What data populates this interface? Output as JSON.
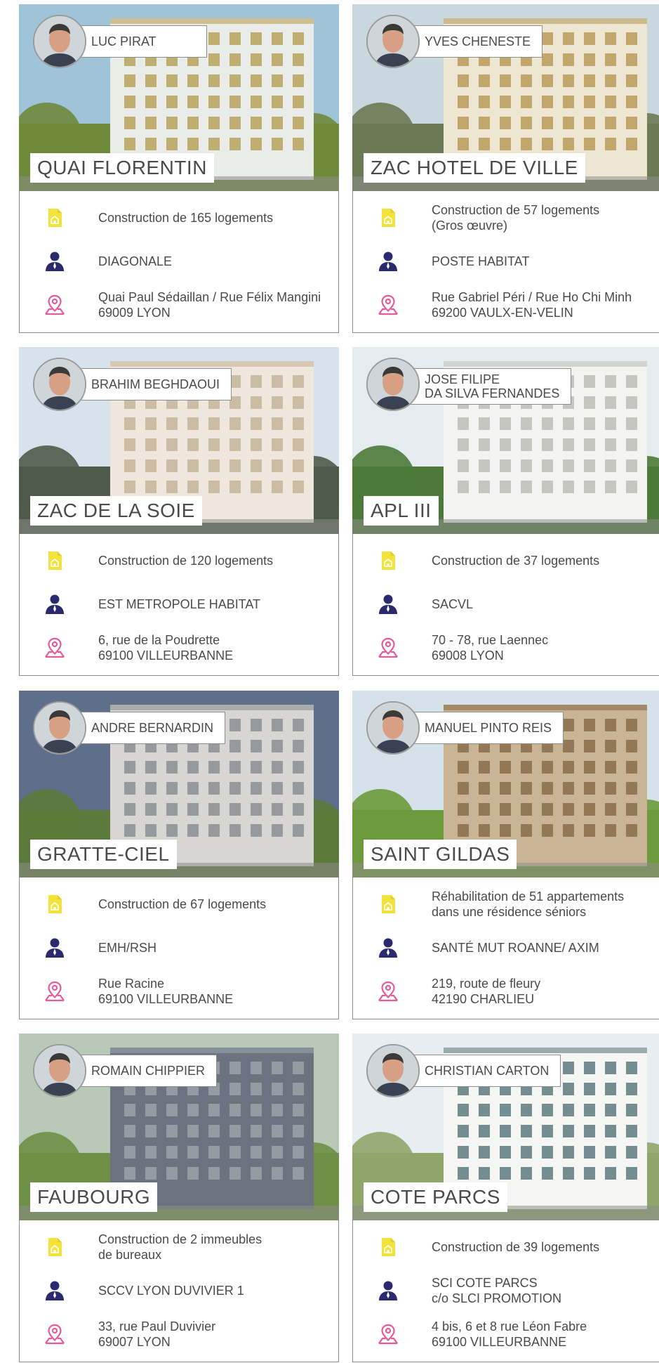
{
  "icons": {
    "building": "building-doc-icon",
    "client": "person-icon",
    "location": "location-pin-icon"
  },
  "colors": {
    "building_icon": "#f2e33b",
    "client_icon": "#2b2a6e",
    "location_icon": "#e45a9a",
    "border": "#8a8a8a",
    "text": "#4a4a4a"
  },
  "projects": [
    {
      "supervisor": "LUC PIRAT",
      "title": "QUAI FLORENTIN",
      "description": "Construction de 165 logements",
      "client": "DIAGONALE",
      "address": "Quai Paul Sédaillan / Rue Félix Mangini\n69009 LYON"
    },
    {
      "supervisor": "YVES CHENESTE",
      "title": "ZAC HOTEL DE VILLE",
      "description": "Construction de 57 logements\n(Gros œuvre)",
      "client": "POSTE HABITAT",
      "address": "Rue Gabriel Péri / Rue Ho Chi Minh\n69200 VAULX-EN-VELIN"
    },
    {
      "supervisor": "BRAHIM BEGHDAOUI",
      "title": "ZAC DE LA SOIE",
      "description": "Construction de 120 logements",
      "client": "EST METROPOLE HABITAT",
      "address": "6, rue de la Poudrette\n69100 VILLEURBANNE"
    },
    {
      "supervisor": "JOSE FILIPE\nDA SILVA FERNANDES",
      "title": "APL III",
      "description": "Construction de 37 logements",
      "client": "SACVL",
      "address": "70 - 78, rue Laennec\n69008 LYON"
    },
    {
      "supervisor": "ANDRE BERNARDIN",
      "title": "GRATTE-CIEL",
      "description": "Construction de 67 logements",
      "client": "EMH/RSH",
      "address": "Rue Racine\n69100 VILLEURBANNE"
    },
    {
      "supervisor": "MANUEL PINTO REIS",
      "title": "SAINT GILDAS",
      "description": "Réhabilitation de 51 appartements\ndans une résidence séniors",
      "client": "SANTÉ MUT ROANNE/ AXIM",
      "address": "219, route de fleury\n42190 CHARLIEU"
    },
    {
      "supervisor": "ROMAIN CHIPPIER",
      "title": "FAUBOURG",
      "description": "Construction de 2 immeubles\nde bureaux",
      "client": "SCCV LYON DUVIVIER 1",
      "address": "33, rue Paul Duvivier\n69007 LYON"
    },
    {
      "supervisor": "CHRISTIAN CARTON",
      "title": "COTE PARCS",
      "description": "Construction de 39 logements",
      "client": "SCI COTE PARCS\nc/o SLCI PROMOTION",
      "address": "4 bis, 6 et 8 rue Léon Fabre\n69100 VILLEURBANNE"
    }
  ]
}
